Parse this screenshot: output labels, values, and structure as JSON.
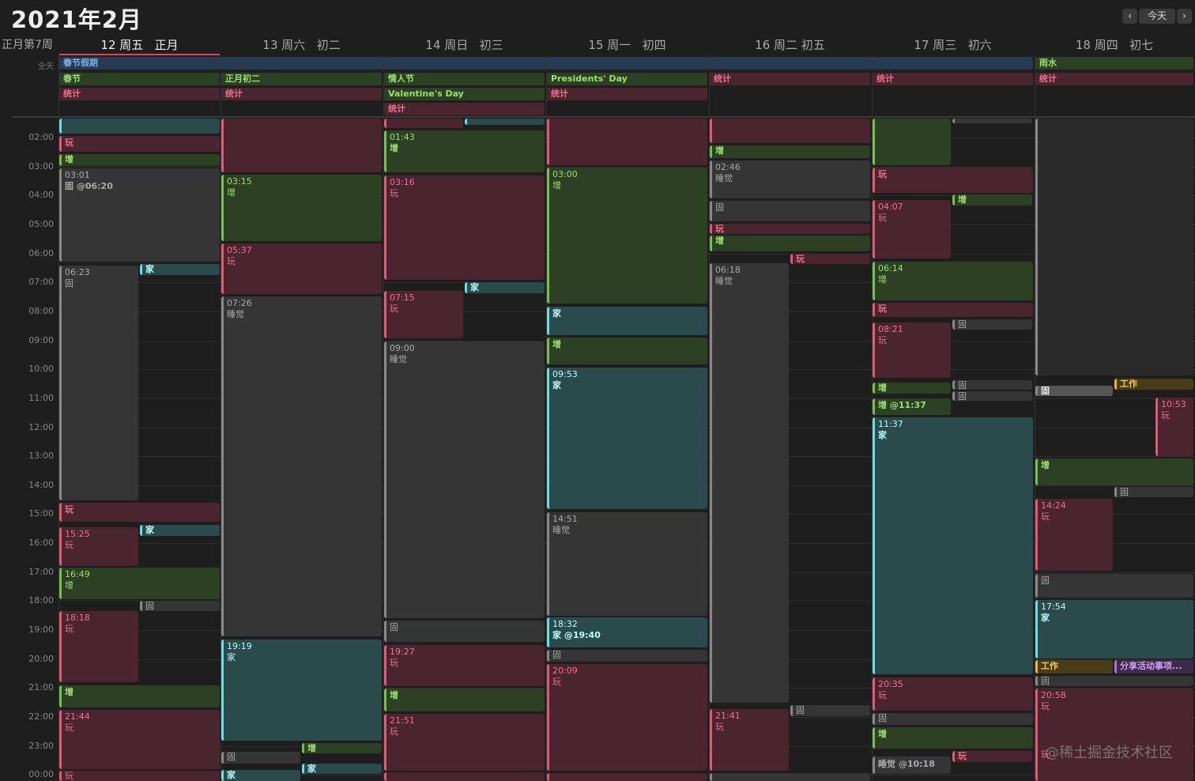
{
  "title": "2021年2月",
  "nav": {
    "prev": "‹",
    "today": "今天",
    "next": "›"
  },
  "week_label": "正月第7周",
  "allday_label": "全天",
  "days": [
    {
      "label": "12 周五   正月"
    },
    {
      "label": "13 周六   初二"
    },
    {
      "label": "14 周日   初三"
    },
    {
      "label": "15 周一   初四"
    },
    {
      "label": "16 周二 初五"
    },
    {
      "label": "17 周三   初六"
    },
    {
      "label": "18 周四   初七"
    }
  ],
  "hours": [
    "02:00",
    "03:00",
    "04:00",
    "05:00",
    "06:00",
    "07:00",
    "08:00",
    "09:00",
    "10:00",
    "11:00",
    "12:00",
    "13:00",
    "14:00",
    "15:00",
    "16:00",
    "17:00",
    "18:00",
    "19:00",
    "20:00",
    "21:00",
    "22:00",
    "23:00",
    "00:00"
  ],
  "allday": {
    "spring_holiday": "春节假期",
    "chunjie": "春节",
    "zhengyuechuer": "正月初二",
    "qingrenjie": "情人节",
    "valentines": "Valentine's Day",
    "presidents": "Presidents' Day",
    "yushui": "雨水",
    "tongji": "统计"
  },
  "labels": {
    "wan": "玩",
    "zeng": "增",
    "jia": "家",
    "gu": "固",
    "shuijiao": "睡觉",
    "gongzuo": "工作",
    "fenxiang": "分享活动事项..."
  },
  "times": {
    "t0301": "03:01",
    "gu0620": "固 @06:20",
    "t0623": "06:23",
    "t1525": "15:25",
    "t1649": "16:49",
    "t1818": "18:18",
    "t2144": "21:44",
    "t0315": "03:15",
    "t0537": "05:37",
    "t0726": "07:26",
    "t1919": "19:19",
    "t0143": "01:43",
    "t0316": "03:16",
    "t0715": "07:15",
    "t0900": "09:00",
    "t1927": "19:27",
    "t2151": "21:51",
    "t0300": "03:00",
    "t0953": "09:53",
    "t1451": "14:51",
    "t1832": "18:32",
    "jia1940": "家 @19:40",
    "t2009": "20:09",
    "t0246": "02:46",
    "t0618": "06:18",
    "t2141": "21:41",
    "t0407": "04:07",
    "t0614": "06:14",
    "t0821": "08:21",
    "zeng1137": "增 @11:37",
    "t1137": "11:37",
    "t2035": "20:35",
    "shui1018": "睡觉 @10:18",
    "t1053": "10:53",
    "t1424": "14:24",
    "t1754": "17:54",
    "t2058": "20:58"
  },
  "watermark": "@稀土掘金技术社区",
  "colors": {
    "wan": "#e0587a",
    "zeng": "#74c050",
    "jia": "#6adfdf",
    "gu": "#888888",
    "gongzuo": "#f0b030",
    "fenxiang": "#b070e0",
    "today_accent": "#e0435e"
  }
}
